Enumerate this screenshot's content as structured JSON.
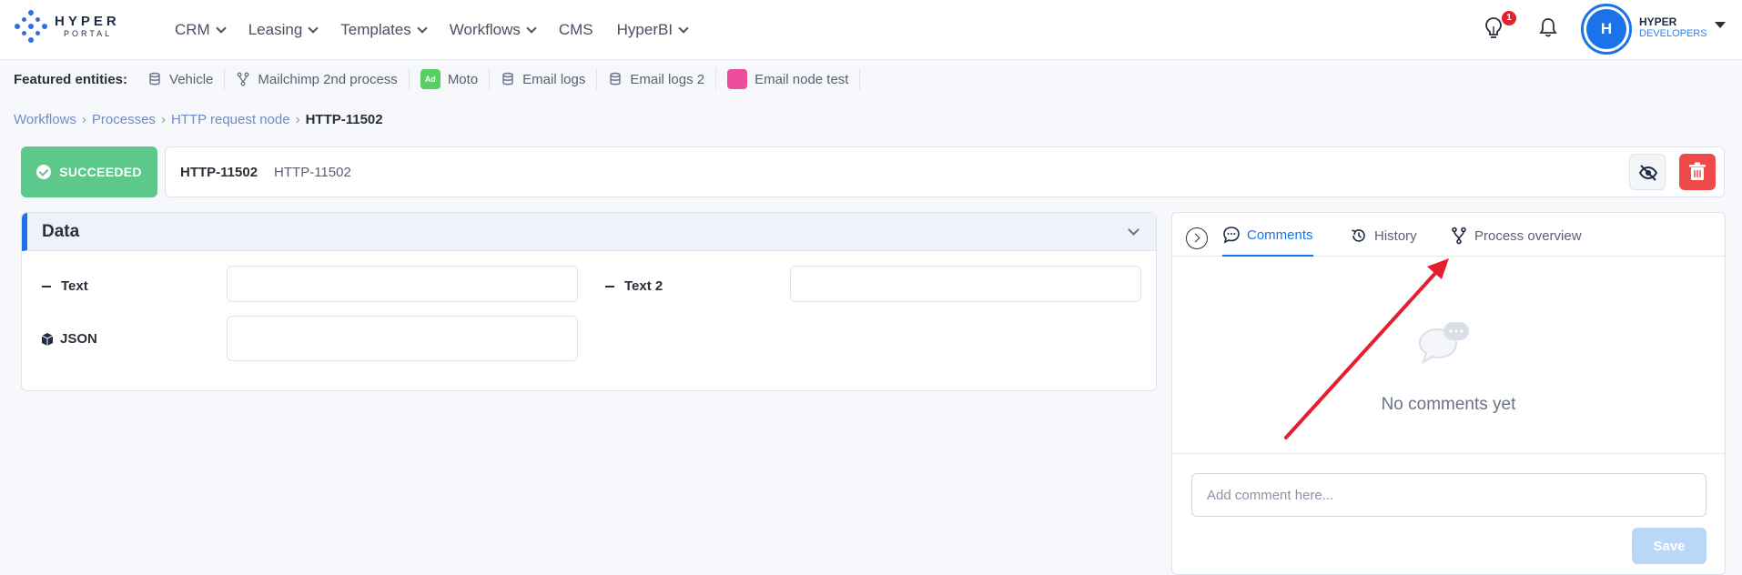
{
  "brand": {
    "line1": "HYPER",
    "line2": "PORTAL"
  },
  "nav": {
    "items": [
      {
        "label": "CRM",
        "dropdown": true
      },
      {
        "label": "Leasing",
        "dropdown": true
      },
      {
        "label": "Templates",
        "dropdown": true
      },
      {
        "label": "Workflows",
        "dropdown": true
      },
      {
        "label": "CMS",
        "dropdown": false
      },
      {
        "label": "HyperBI",
        "dropdown": true
      }
    ]
  },
  "user": {
    "notifications_badge": "1",
    "avatar_initial": "H",
    "org_line1": "HYPER",
    "org_line2": "DEVELOPERS"
  },
  "featured": {
    "label": "Featured entities:",
    "items": [
      {
        "label": "Vehicle",
        "icon": "database-icon"
      },
      {
        "label": "Mailchimp 2nd process",
        "icon": "process-icon"
      },
      {
        "label": "Moto",
        "icon": "green-square-icon",
        "icon_text": "Ad"
      },
      {
        "label": "Email logs",
        "icon": "database-icon"
      },
      {
        "label": "Email logs 2",
        "icon": "database-icon"
      },
      {
        "label": "Email node test",
        "icon": "pink-square-icon"
      }
    ]
  },
  "breadcrumb": {
    "items": [
      "Workflows",
      "Processes",
      "HTTP request node"
    ],
    "separator": "›",
    "current": "HTTP-11502"
  },
  "header": {
    "status": "SUCCEEDED",
    "id": "HTTP-11502",
    "name": "HTTP-11502",
    "status_color": "#5cc98a",
    "delete_color": "#ee4a4a"
  },
  "data_panel": {
    "title": "Data",
    "fields": [
      {
        "label": "Text",
        "value": ""
      },
      {
        "label": "Text 2",
        "value": ""
      },
      {
        "label": "JSON",
        "value": ""
      }
    ]
  },
  "side_panel": {
    "tabs": [
      {
        "label": "Comments",
        "active": true
      },
      {
        "label": "History",
        "active": false
      },
      {
        "label": "Process overview",
        "active": false
      }
    ],
    "empty_text": "No comments yet",
    "comment_placeholder": "Add comment here...",
    "save_label": "Save"
  }
}
